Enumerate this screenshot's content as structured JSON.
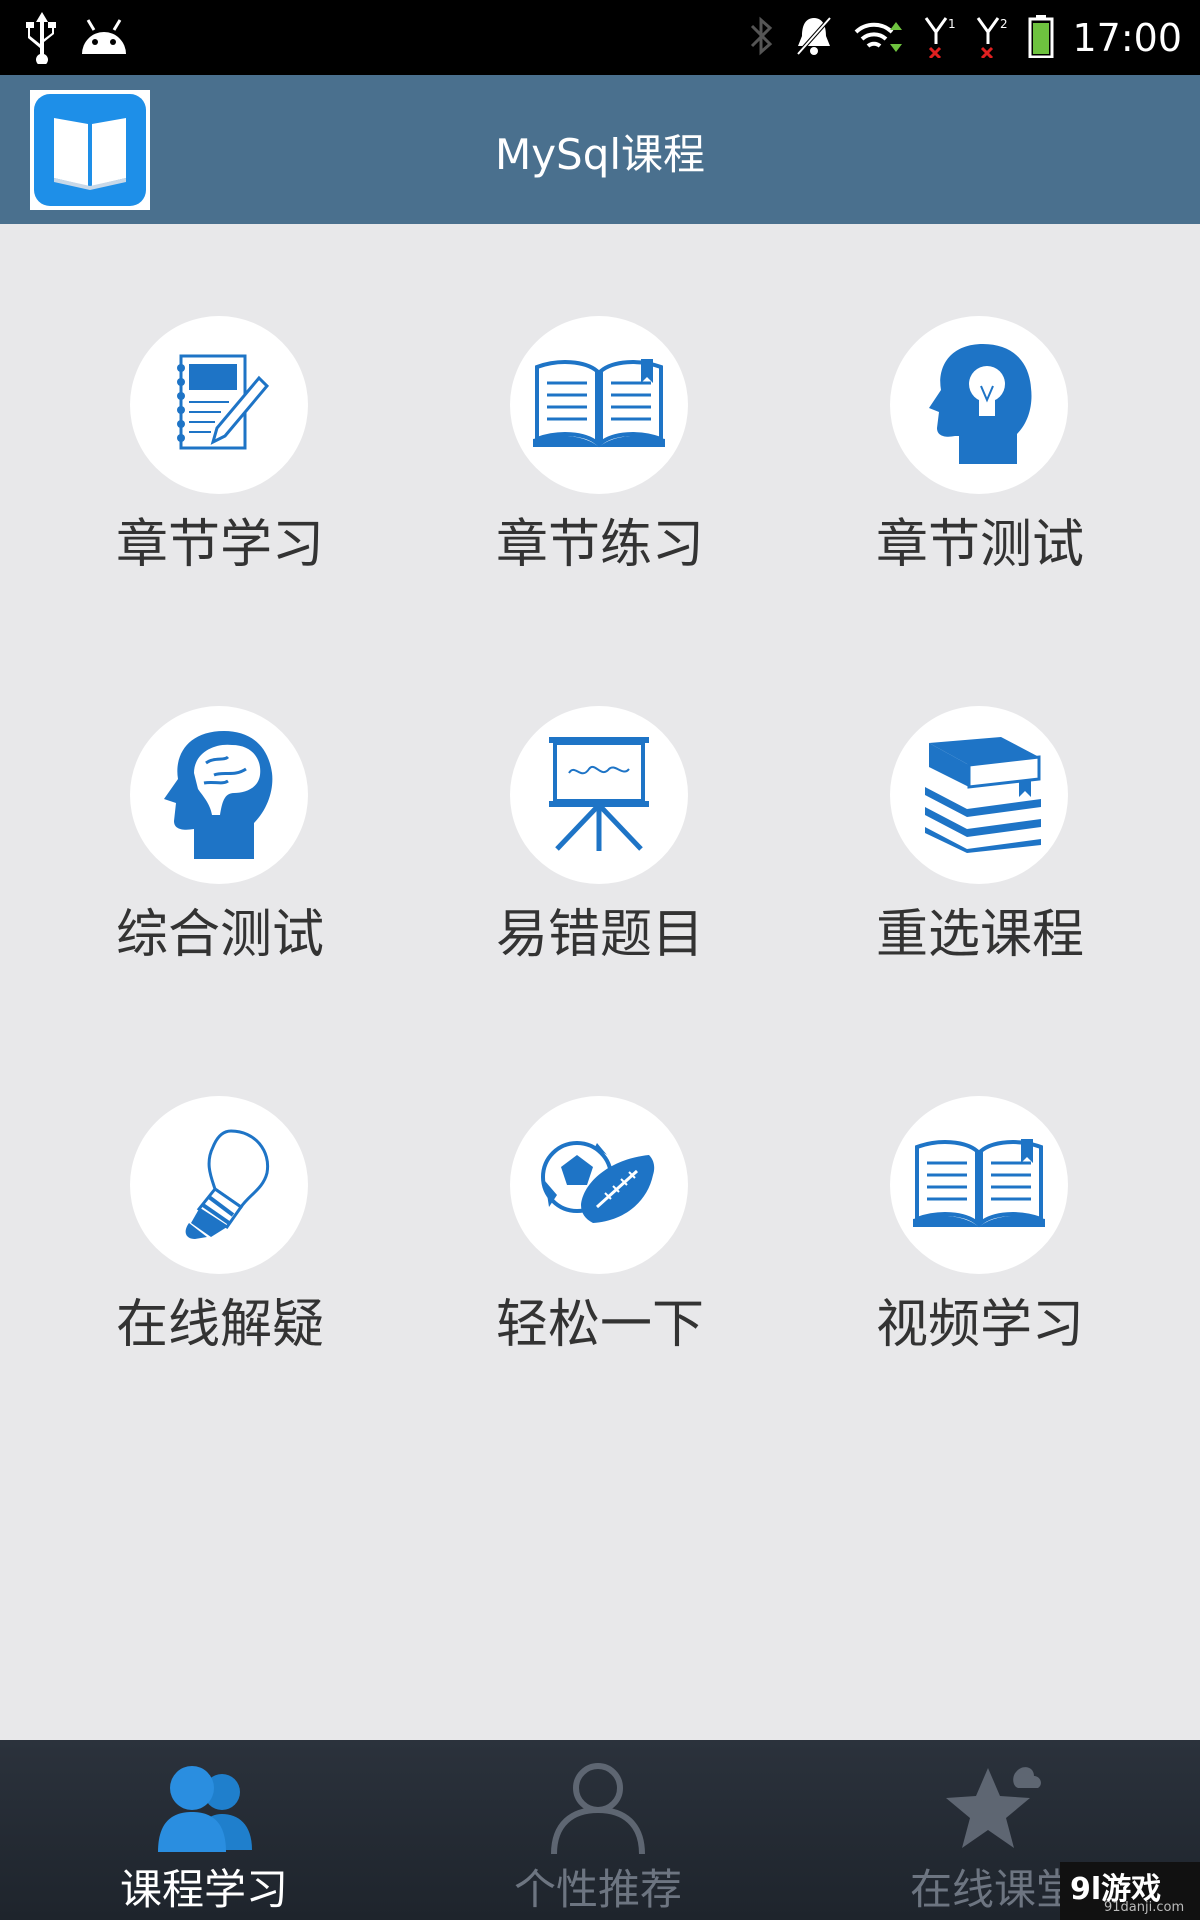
{
  "status_bar": {
    "time": "17:00",
    "icons": [
      "usb-icon",
      "android-icon",
      "bluetooth-icon",
      "mute-icon",
      "wifi-icon",
      "signal-1-icon",
      "signal-2-icon",
      "battery-icon"
    ]
  },
  "header": {
    "title": "MySql课程",
    "logo_icon": "book-icon"
  },
  "grid": {
    "items": [
      {
        "label": "章节学习",
        "icon": "notebook-pencil-icon"
      },
      {
        "label": "章节练习",
        "icon": "open-book-icon"
      },
      {
        "label": "章节测试",
        "icon": "head-bulb-icon"
      },
      {
        "label": "综合测试",
        "icon": "head-brain-icon"
      },
      {
        "label": "易错题目",
        "icon": "easel-board-icon"
      },
      {
        "label": "重选课程",
        "icon": "book-stack-icon"
      },
      {
        "label": "在线解疑",
        "icon": "lightbulb-icon"
      },
      {
        "label": "轻松一下",
        "icon": "balls-icon"
      },
      {
        "label": "视频学习",
        "icon": "open-book-icon"
      }
    ]
  },
  "bottom_nav": {
    "items": [
      {
        "label": "课程学习",
        "icon": "users-icon",
        "active": true
      },
      {
        "label": "个性推荐",
        "icon": "person-outline-icon",
        "active": false
      },
      {
        "label": "在线课堂",
        "icon": "star-icon",
        "active": false
      }
    ]
  },
  "watermark": {
    "main": "9l游戏",
    "sub": "91danji.com"
  },
  "colors": {
    "accent": "#1e74c6",
    "header_bg": "#4a708e",
    "page_bg": "#e8e8ea",
    "nav_bg": "#262c35",
    "nav_active_icon": "#2a8ee0"
  }
}
